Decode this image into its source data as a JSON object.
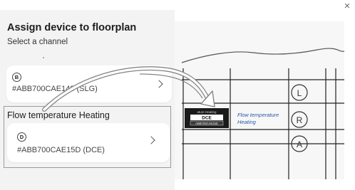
{
  "dialog": {
    "title": "Assign device to floorplan",
    "subtitle": "Select a channel",
    "close_label": "×"
  },
  "channels": [
    {
      "badge": "B",
      "id": "#ABB700CAE148 (SLG)"
    },
    {
      "badge": "D",
      "id": "#ABB700CAE15D (DCE)"
    }
  ],
  "selected": {
    "label": "Flow temperature Heating"
  },
  "floorplan": {
    "device_top": "ature Heating",
    "device_code": "DCE",
    "device_id": "ABB700CAE15D",
    "handwritten_line1": "Flow temperature",
    "handwritten_line2": "Heating",
    "circle_letters": [
      "L",
      "R",
      "A"
    ]
  },
  "colors": {
    "panel_bg": "#f3f3f3",
    "card_bg": "#ffffff",
    "selection_border": "#9a9a9a",
    "device_tag_bg": "#1a1a1a",
    "handwritten_text": "#2a5aa8",
    "arrow_stroke": "#808080"
  },
  "icons": {
    "close": "close-icon",
    "chevron": "chevron-right-icon",
    "arrow": "curved-arrow-graphic"
  }
}
